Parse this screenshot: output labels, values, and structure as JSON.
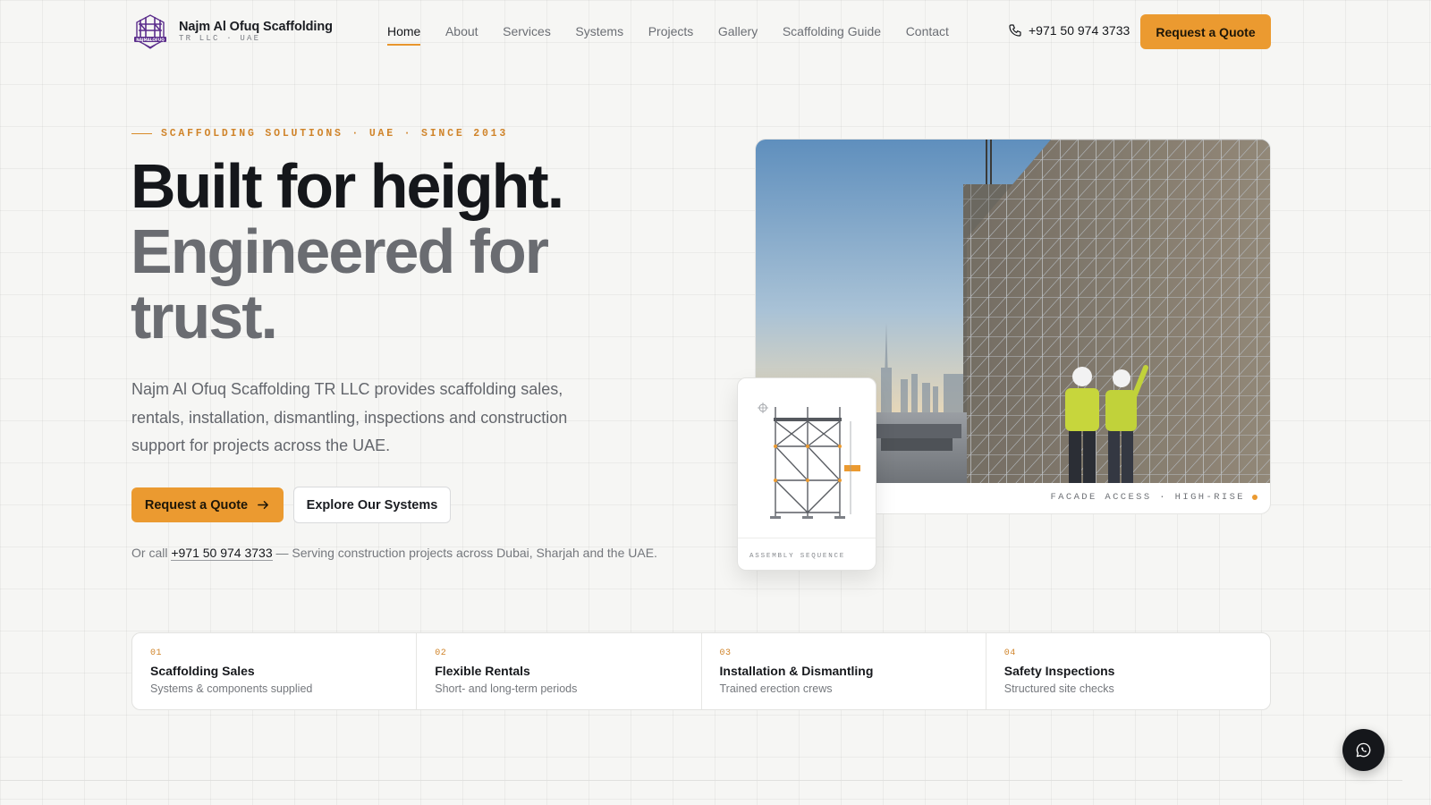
{
  "brand": {
    "name": "Najm Al Ofuq Scaffolding",
    "sub": "TR LLC · UAE",
    "logo_text": "NAJMALOFUQ"
  },
  "nav": {
    "items": [
      "Home",
      "About",
      "Services",
      "Systems",
      "Projects",
      "Gallery",
      "Scaffolding Guide",
      "Contact"
    ],
    "active": "Home"
  },
  "header": {
    "phone": "+971 50 974 3733",
    "cta": "Request a Quote",
    "phone_icon": "phone-icon"
  },
  "hero": {
    "eyebrow": "SCAFFOLDING SOLUTIONS · UAE · SINCE 2013",
    "headline_1": "Built for height.",
    "headline_2": "Engineered for",
    "headline_3": "trust.",
    "lead": "Najm Al Ofuq Scaffolding TR LLC provides scaffolding sales, rentals, installation, dismantling, inspections and construction support for projects across the UAE.",
    "primary_cta": "Request a Quote",
    "secondary_cta": "Explore Our Systems",
    "call_prefix": "Or call",
    "call_number": "+971 50 974 3733",
    "call_suffix": "— Serving construction projects across Dubai, Sharjah and the UAE."
  },
  "photo_card": {
    "caption": "FACADE ACCESS · HIGH-RISE"
  },
  "diagram_card": {
    "caption": "ASSEMBLY SEQUENCE"
  },
  "features": [
    {
      "num": "01",
      "title": "Scaffolding Sales",
      "sub": "Systems & components supplied"
    },
    {
      "num": "02",
      "title": "Flexible Rentals",
      "sub": "Short- and long-term periods"
    },
    {
      "num": "03",
      "title": "Installation & Dismantling",
      "sub": "Trained erection crews"
    },
    {
      "num": "04",
      "title": "Safety Inspections",
      "sub": "Structured site checks"
    }
  ],
  "colors": {
    "accent": "#eb9a30",
    "ink": "#15171b",
    "muted": "#6a6c71",
    "background": "#f6f6f4"
  }
}
